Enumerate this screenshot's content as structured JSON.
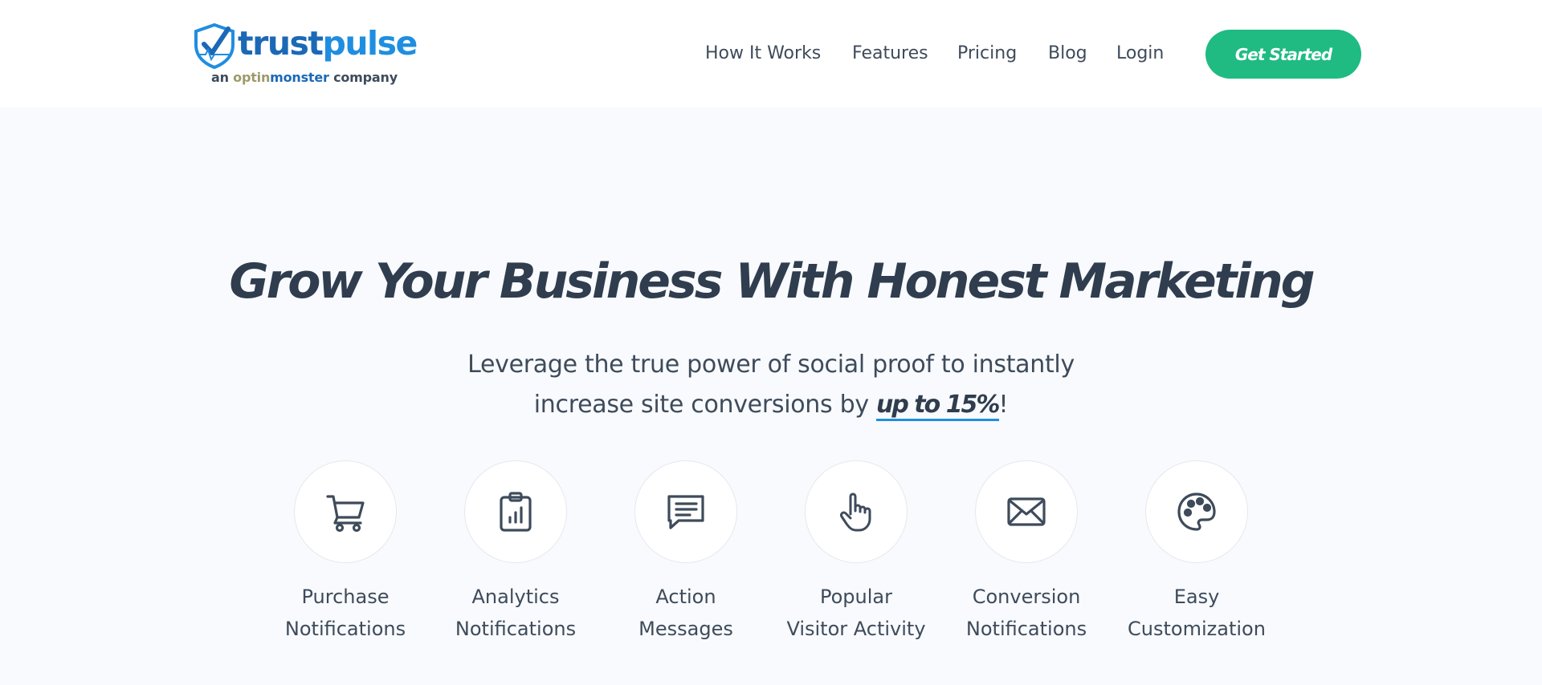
{
  "brand": {
    "name_trust": "trust",
    "name_pulse": "pulse",
    "tag_prefix": "an ",
    "tag_optin": "optin",
    "tag_monster": "monster",
    "tag_suffix": " company",
    "primary_color": "#1b69b6",
    "accent_color": "#1f8ee0"
  },
  "nav": {
    "items": [
      {
        "label": "How It Works"
      },
      {
        "label": "Features"
      },
      {
        "label": "Pricing"
      },
      {
        "label": "Blog"
      },
      {
        "label": "Login"
      }
    ],
    "cta_label": "Get Started",
    "cta_color": "#1fbb83"
  },
  "hero": {
    "title": "Grow Your Business With Honest Marketing",
    "subtitle_line1": "Leverage the true power of social proof to instantly",
    "subtitle_line2_pre": "increase site conversions by ",
    "subtitle_highlight": "up to 15%",
    "subtitle_line2_post": "!"
  },
  "features": [
    {
      "icon": "cart-icon",
      "label": "Purchase\nNotifications"
    },
    {
      "icon": "clipboard-chart-icon",
      "label": "Analytics\nNotifications"
    },
    {
      "icon": "message-icon",
      "label": "Action\nMessages"
    },
    {
      "icon": "pointer-hand-icon",
      "label": "Popular\nVisitor Activity"
    },
    {
      "icon": "envelope-icon",
      "label": "Conversion\nNotifications"
    },
    {
      "icon": "palette-icon",
      "label": "Easy\nCustomization"
    }
  ]
}
